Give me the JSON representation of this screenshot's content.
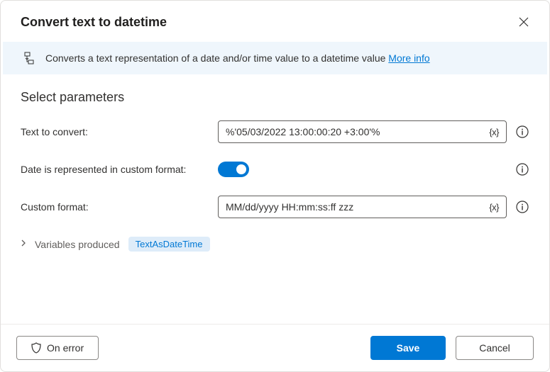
{
  "title": "Convert text to datetime",
  "info": {
    "text": "Converts a text representation of a date and/or time value to a datetime value ",
    "more_label": "More info"
  },
  "section_title": "Select parameters",
  "fields": {
    "text_to_convert": {
      "label": "Text to convert:",
      "value": "%'05/03/2022 13:00:00:20 +3:00'%"
    },
    "custom_format_toggle": {
      "label": "Date is represented in custom format:",
      "on": true
    },
    "custom_format": {
      "label": "Custom format:",
      "value": "MM/dd/yyyy HH:mm:ss:ff zzz"
    }
  },
  "variables": {
    "label": "Variables produced",
    "items": [
      "TextAsDateTime"
    ]
  },
  "footer": {
    "on_error": "On error",
    "save": "Save",
    "cancel": "Cancel"
  },
  "var_token": "{x}"
}
